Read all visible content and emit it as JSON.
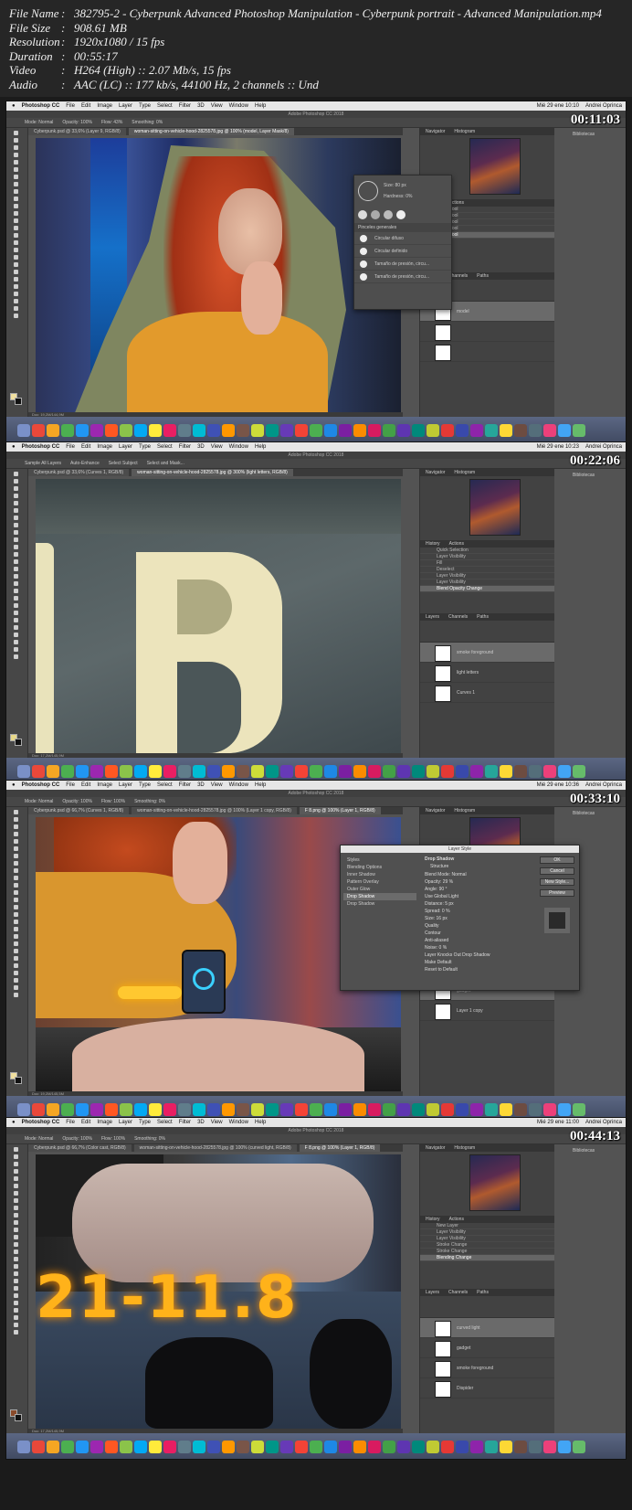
{
  "info": {
    "rows": [
      {
        "k": "File Name",
        "v": "382795-2 - Cyberpunk Advanced Photoshop Manipulation - Cyberpunk portrait - Advanced Manipulation.mp4"
      },
      {
        "k": "File Size",
        "v": "908.61 MB"
      },
      {
        "k": "Resolution",
        "v": "1920x1080 / 15 fps"
      },
      {
        "k": "Duration",
        "v": "00:55:17"
      },
      {
        "k": "Video",
        "v": "H264 (High) :: 2.07 Mb/s, 15 fps"
      },
      {
        "k": "Audio",
        "v": "AAC (LC) :: 177 kb/s, 44100 Hz, 2 channels :: Und"
      }
    ]
  },
  "app": {
    "name": "Photoshop CC",
    "menus": [
      "File",
      "Edit",
      "Image",
      "Layer",
      "Type",
      "Select",
      "Filter",
      "3D",
      "View",
      "Window",
      "Help"
    ],
    "title": "Adobe Photoshop CC 2018",
    "user": "Andrei Oprinca",
    "panels": [
      "Navigator",
      "Histogram"
    ],
    "history_tabs": [
      "History",
      "Actions"
    ],
    "layer_tabs": [
      "Layers",
      "Channels",
      "Paths"
    ],
    "library": "Bibliotecas"
  },
  "frames": [
    {
      "timecode": "00:11:03",
      "clock": "Mié 29 ene 10:10",
      "tabs": [
        "Cyberpunk.psd @ 33,6% (Layer 9, RGB/8)",
        "woman-sitting-on-vehicle-hood-2825578.jpg @ 100% (model, Layer Mask/8)"
      ],
      "options": [
        "Mode: Normal",
        "Opacity: 100%",
        "Flow: 43%",
        "Smoothing: 0%"
      ],
      "status": "Doc: 19,2M/144,9M",
      "history": [
        "Brush Tool",
        "Brush Tool",
        "Brush Tool",
        "Brush Tool",
        "Brush Tool"
      ],
      "layers": [
        "model",
        "",
        ""
      ],
      "brush": {
        "size_label": "Size:",
        "size": "80 px",
        "hard_label": "Hardness:",
        "hard": "0%",
        "folder": "Pinceles generales",
        "items": [
          "Circular difuso",
          "Circular definido",
          "Tamaño de presión, circu...",
          "Tamaño de presión, circu..."
        ]
      }
    },
    {
      "timecode": "00:22:06",
      "clock": "Mié 29 ene 10:23",
      "tabs": [
        "Cyberpunk.psd @ 33,6% (Curves 1, RGB/8)",
        "woman-sitting-on-vehicle-hood-2825578.jpg @ 300% (light letters, RGB/8)"
      ],
      "options": [
        "Sample All Layers",
        "Auto-Enhance",
        "Select Subject",
        "Select and Mask..."
      ],
      "status": "Doc: 17,2M/145,9M",
      "history": [
        "Quick Selection",
        "Layer Visibility",
        "Fill",
        "Deselect",
        "Layer Visibility",
        "Layer Visibility",
        "Blend Opacity Change"
      ],
      "layers": [
        "smoke foreground",
        "light letters",
        "Curves 1"
      ]
    },
    {
      "timecode": "00:33:10",
      "clock": "Mié 29 ene 10:36",
      "tabs": [
        "Cyberpunk.psd @ 66,7% (Curves 1, RGB/8)",
        "woman-sitting-on-vehicle-hood-2825578.jpg @ 100% (Layer 1 copy, RGB/8)",
        "F 8.png @ 100% (Layer 1, RGB/8)"
      ],
      "options": [
        "Mode: Normal",
        "Opacity: 100%",
        "Flow: 100%",
        "Smoothing: 0%"
      ],
      "status": "Doc: 19,2M/145,5M",
      "history": [],
      "layers": [
        "gadget",
        "Layer 1 copy"
      ],
      "dialog": {
        "title": "Layer Style",
        "styles": [
          "Styles",
          "Blending Options",
          "Inner Shadow",
          "Pattern Overlay",
          "Outer Glow",
          "Drop Shadow",
          "Drop Shadow"
        ],
        "section": "Drop Shadow",
        "sub": "Structure",
        "fields": [
          "Blend Mode: Normal",
          "Opacity: 29 %",
          "Angle: 90 °",
          "Use Global Light",
          "Distance: 5 px",
          "Spread: 0 %",
          "Size: 16 px",
          "Quality",
          "Contour",
          "Anti-aliased",
          "Noise: 0 %",
          "Layer Knocks Out Drop Shadow",
          "Make Default",
          "Reset to Default"
        ],
        "buttons": [
          "OK",
          "Cancel",
          "New Style...",
          "Preview"
        ]
      }
    },
    {
      "timecode": "00:44:13",
      "clock": "Mié 29 ene 11:00",
      "tabs": [
        "Cyberpunk.psd @ 66,7% (Color cast, RGB/8)",
        "woman-sitting-on-vehicle-hood-2825578.jpg @ 100% (curved light, RGB/8)",
        "F 8.png @ 100% (Layer 1, RGB/8)"
      ],
      "options": [
        "Mode: Normal",
        "Opacity: 100%",
        "Flow: 100%",
        "Smoothing: 0%"
      ],
      "status": "Doc: 17,2M/145,9M",
      "history": [
        "New Layer",
        "Layer Visibility",
        "Layer Visibility",
        "Stroke Change",
        "Stroke Change",
        "Blending Change"
      ],
      "layers": [
        "curved light",
        "gadget",
        "smoke foreground",
        "Dispider"
      ]
    }
  ],
  "canvas_text": {
    "plate_b": "B",
    "plate_t": "T",
    "plate_digits": "21-11.8"
  }
}
